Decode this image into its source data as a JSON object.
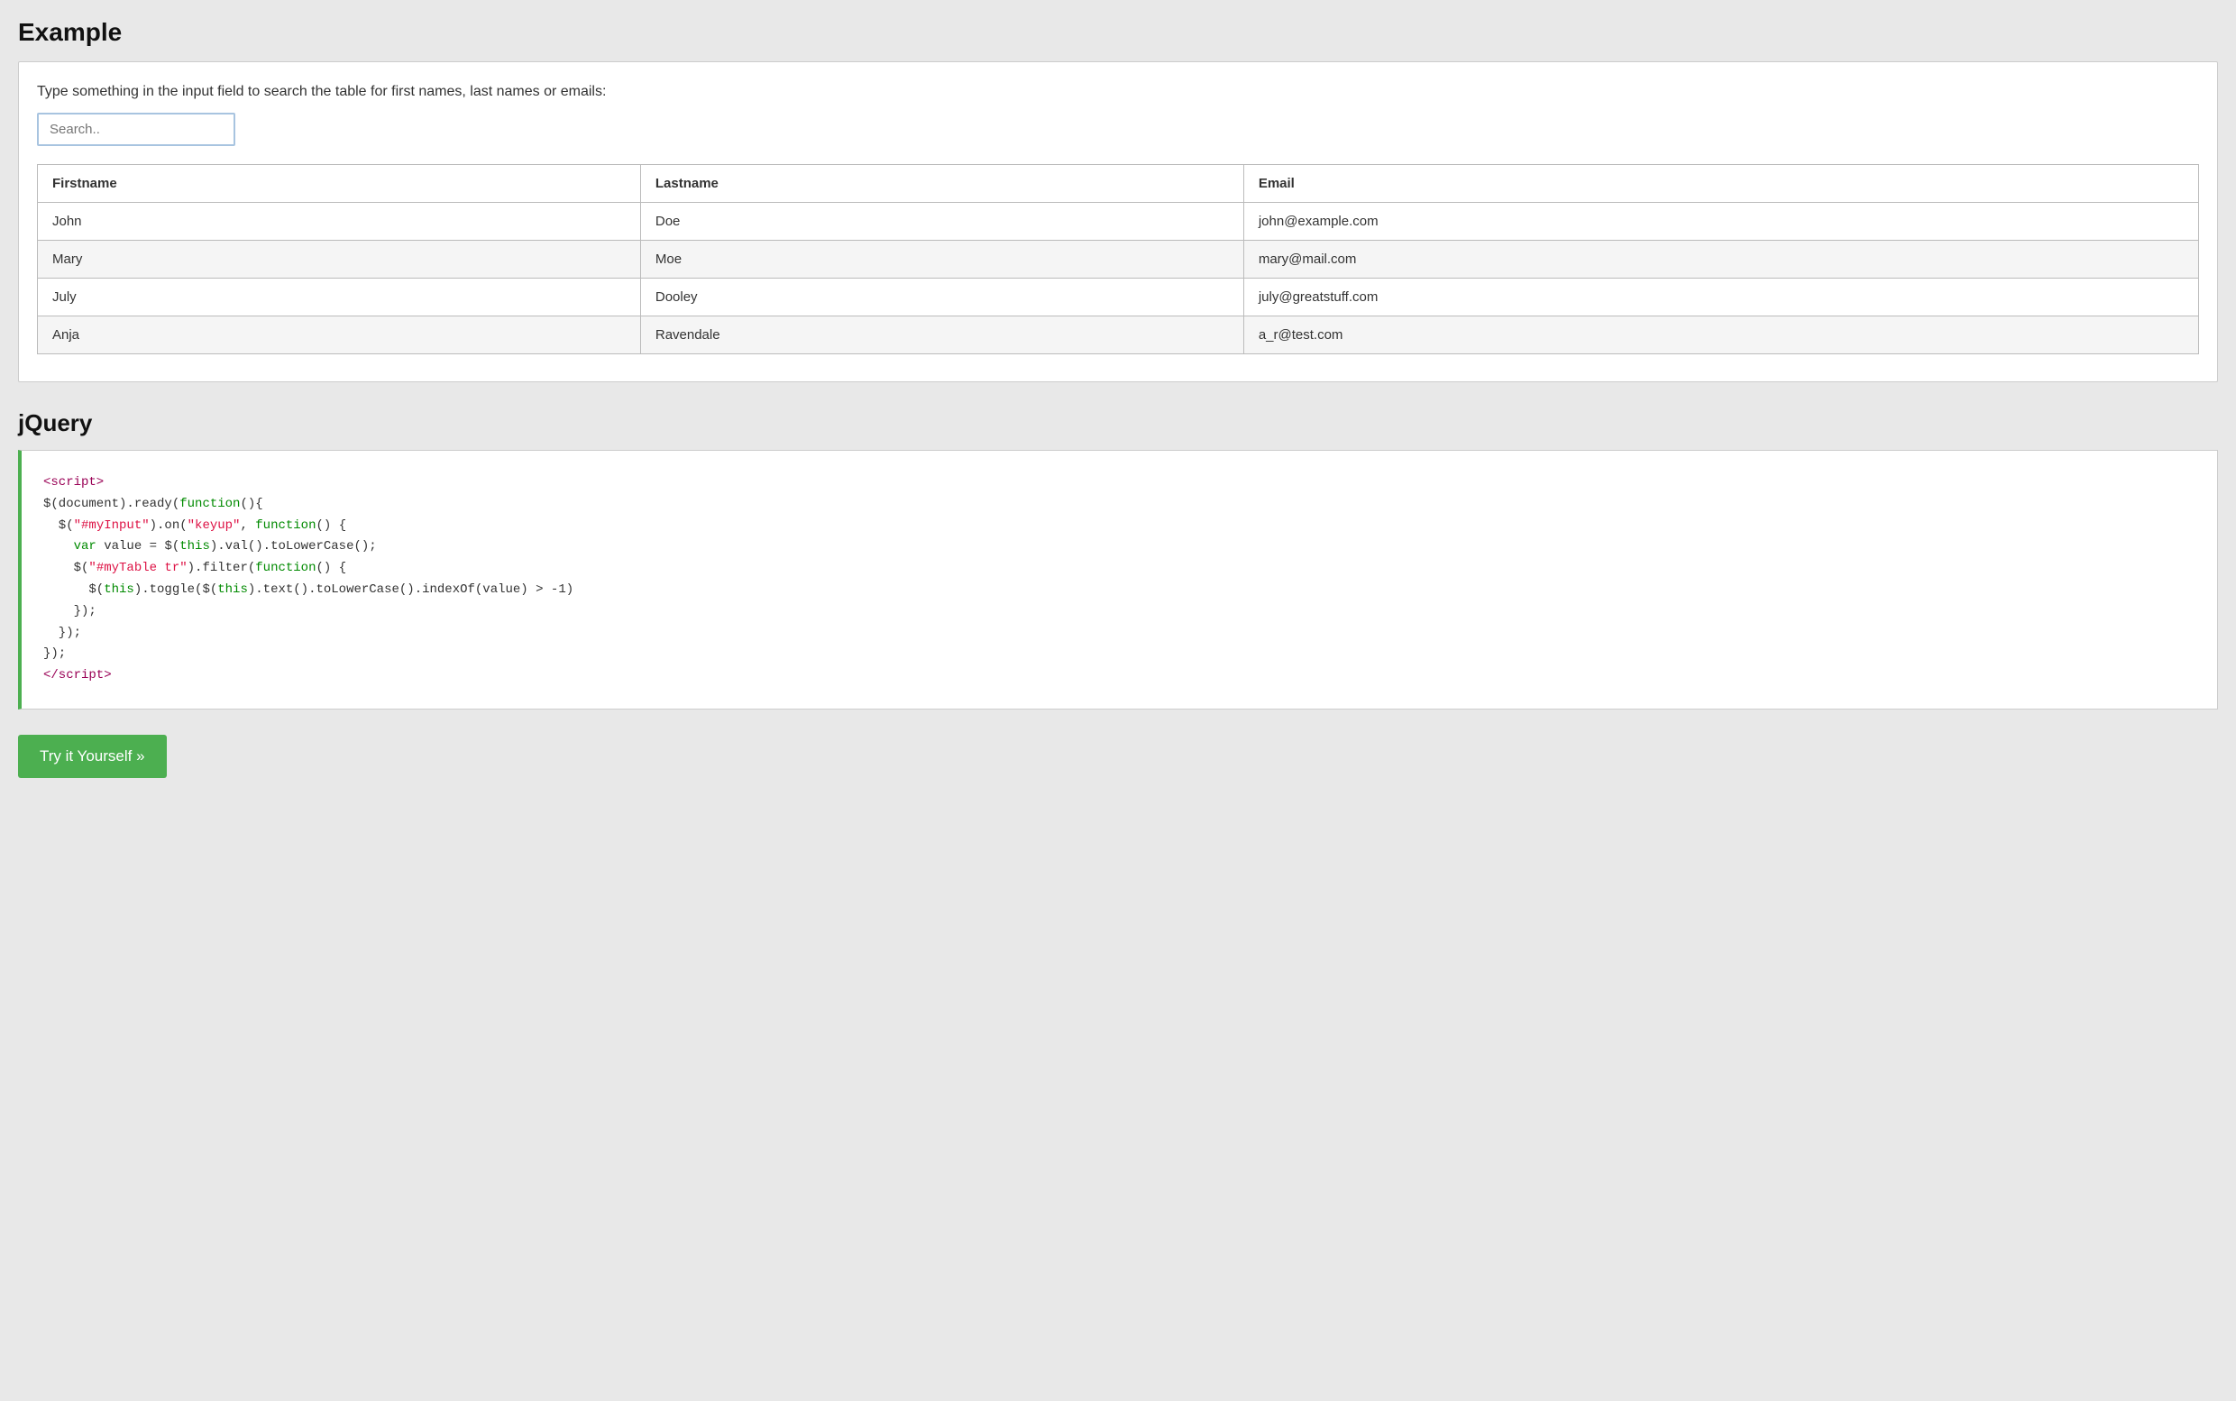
{
  "page": {
    "example_title": "Example",
    "jquery_title": "jQuery",
    "instruction": "Type something in the input field to search the table for first names, last names or emails:",
    "search_placeholder": "Search..",
    "table": {
      "headers": [
        "Firstname",
        "Lastname",
        "Email"
      ],
      "rows": [
        [
          "John",
          "Doe",
          "john@example.com"
        ],
        [
          "Mary",
          "Moe",
          "mary@mail.com"
        ],
        [
          "July",
          "Dooley",
          "july@greatstuff.com"
        ],
        [
          "Anja",
          "Ravendale",
          "a_r@test.com"
        ]
      ]
    },
    "try_button_label": "Try it Yourself »"
  }
}
